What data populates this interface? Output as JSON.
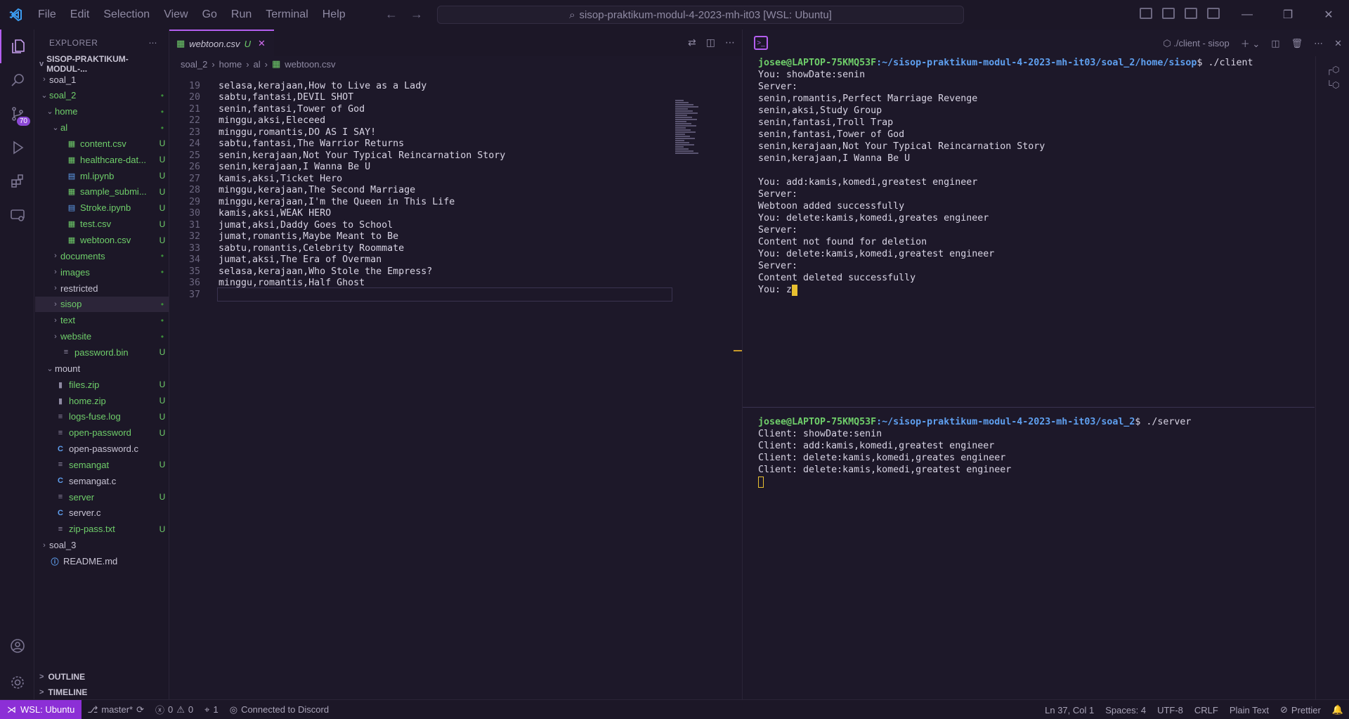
{
  "titlebar": {
    "menu": [
      "File",
      "Edit",
      "Selection",
      "View",
      "Go",
      "Run",
      "Terminal",
      "Help"
    ],
    "search_text": "sisop-praktikum-modul-4-2023-mh-it03 [WSL: Ubuntu]"
  },
  "activity": {
    "badge": "70"
  },
  "sidebar": {
    "header": "EXPLORER",
    "project": "SISOP-PRAKTIKUM-MODUL-...",
    "tree": [
      {
        "label": "soal_1",
        "chev": ">",
        "indent": 0,
        "type": "folder",
        "status": ""
      },
      {
        "label": "soal_2",
        "chev": "v",
        "indent": 0,
        "type": "folder",
        "status": "•",
        "green": true
      },
      {
        "label": "home",
        "chev": "v",
        "indent": 1,
        "type": "folder",
        "status": "•",
        "green": true
      },
      {
        "label": "al",
        "chev": "v",
        "indent": 2,
        "type": "folder",
        "status": "•",
        "green": true
      },
      {
        "label": "content.csv",
        "chev": "",
        "indent": 3,
        "type": "csv",
        "status": "U",
        "green": true
      },
      {
        "label": "healthcare-dat...",
        "chev": "",
        "indent": 3,
        "type": "csv",
        "status": "U",
        "green": true
      },
      {
        "label": "ml.ipynb",
        "chev": "",
        "indent": 3,
        "type": "nb",
        "status": "U",
        "green": true
      },
      {
        "label": "sample_submi...",
        "chev": "",
        "indent": 3,
        "type": "csv",
        "status": "U",
        "green": true
      },
      {
        "label": "Stroke.ipynb",
        "chev": "",
        "indent": 3,
        "type": "nb",
        "status": "U",
        "green": true
      },
      {
        "label": "test.csv",
        "chev": "",
        "indent": 3,
        "type": "csv",
        "status": "U",
        "green": true
      },
      {
        "label": "webtoon.csv",
        "chev": "",
        "indent": 3,
        "type": "csv",
        "status": "U",
        "green": true
      },
      {
        "label": "documents",
        "chev": ">",
        "indent": 2,
        "type": "folder",
        "status": "•",
        "green": true
      },
      {
        "label": "images",
        "chev": ">",
        "indent": 2,
        "type": "folder",
        "status": "•",
        "green": true
      },
      {
        "label": "restricted",
        "chev": ">",
        "indent": 2,
        "type": "folder",
        "status": ""
      },
      {
        "label": "sisop",
        "chev": ">",
        "indent": 2,
        "type": "folder",
        "status": "•",
        "green": true,
        "selected": true
      },
      {
        "label": "text",
        "chev": ">",
        "indent": 2,
        "type": "folder",
        "status": "•",
        "green": true
      },
      {
        "label": "website",
        "chev": ">",
        "indent": 2,
        "type": "folder",
        "status": "•",
        "green": true
      },
      {
        "label": "password.bin",
        "chev": "",
        "indent": 2,
        "type": "file",
        "status": "U",
        "green": true
      },
      {
        "label": "mount",
        "chev": "v",
        "indent": 1,
        "type": "folder",
        "status": ""
      },
      {
        "label": "files.zip",
        "chev": "",
        "indent": 1,
        "type": "zip",
        "status": "U",
        "green": true
      },
      {
        "label": "home.zip",
        "chev": "",
        "indent": 1,
        "type": "zip",
        "status": "U",
        "green": true
      },
      {
        "label": "logs-fuse.log",
        "chev": "",
        "indent": 1,
        "type": "file",
        "status": "U",
        "green": true
      },
      {
        "label": "open-password",
        "chev": "",
        "indent": 1,
        "type": "file",
        "status": "U",
        "green": true
      },
      {
        "label": "open-password.c",
        "chev": "",
        "indent": 1,
        "type": "c",
        "status": ""
      },
      {
        "label": "semangat",
        "chev": "",
        "indent": 1,
        "type": "file",
        "status": "U",
        "green": true
      },
      {
        "label": "semangat.c",
        "chev": "",
        "indent": 1,
        "type": "c",
        "status": ""
      },
      {
        "label": "server",
        "chev": "",
        "indent": 1,
        "type": "file",
        "status": "U",
        "green": true
      },
      {
        "label": "server.c",
        "chev": "",
        "indent": 1,
        "type": "c",
        "status": ""
      },
      {
        "label": "zip-pass.txt",
        "chev": "",
        "indent": 1,
        "type": "file",
        "status": "U",
        "green": true
      },
      {
        "label": "soal_3",
        "chev": ">",
        "indent": 0,
        "type": "folder",
        "status": ""
      },
      {
        "label": "README.md",
        "chev": "",
        "indent": 0,
        "type": "info",
        "status": ""
      }
    ],
    "outline": "OUTLINE",
    "timeline": "TIMELINE"
  },
  "editor": {
    "tab_name": "webtoon.csv",
    "tab_status": "U",
    "breadcrumb": [
      "soal_2",
      "home",
      "al",
      "webtoon.csv"
    ],
    "lines": [
      {
        "n": "19",
        "t": "selasa,kerajaan,How to Live as a Lady"
      },
      {
        "n": "20",
        "t": "sabtu,fantasi,DEVIL SHOT"
      },
      {
        "n": "21",
        "t": "senin,fantasi,Tower of God"
      },
      {
        "n": "22",
        "t": "minggu,aksi,Eleceed"
      },
      {
        "n": "23",
        "t": "minggu,romantis,DO AS I SAY!"
      },
      {
        "n": "24",
        "t": "sabtu,fantasi,The Warrior Returns"
      },
      {
        "n": "25",
        "t": "senin,kerajaan,Not Your Typical Reincarnation Story"
      },
      {
        "n": "26",
        "t": "senin,kerajaan,I Wanna Be U"
      },
      {
        "n": "27",
        "t": "kamis,aksi,Ticket Hero"
      },
      {
        "n": "28",
        "t": "minggu,kerajaan,The Second Marriage"
      },
      {
        "n": "29",
        "t": "minggu,kerajaan,I'm the Queen in This Life"
      },
      {
        "n": "30",
        "t": "kamis,aksi,WEAK HERO"
      },
      {
        "n": "31",
        "t": "jumat,aksi,Daddy Goes to School"
      },
      {
        "n": "32",
        "t": "jumat,romantis,Maybe Meant to Be"
      },
      {
        "n": "33",
        "t": "sabtu,romantis,Celebrity Roommate"
      },
      {
        "n": "34",
        "t": "jumat,aksi,The Era of Overman"
      },
      {
        "n": "35",
        "t": "selasa,kerajaan,Who Stole the Empress?"
      },
      {
        "n": "36",
        "t": "minggu,romantis,Half Ghost"
      },
      {
        "n": "37",
        "t": ""
      }
    ]
  },
  "terminal": {
    "title": "./client - sisop",
    "client": {
      "prompt_user": "josee@LAPTOP-75KMQ53F",
      "prompt_path": ":~/sisop-praktikum-modul-4-2023-mh-it03/soal_2/home/sisop",
      "command": "$ ./client",
      "output": [
        "You: showDate:senin",
        "Server:",
        "senin,romantis,Perfect Marriage Revenge",
        "senin,aksi,Study Group",
        "senin,fantasi,Troll Trap",
        "senin,fantasi,Tower of God",
        "senin,kerajaan,Not Your Typical Reincarnation Story",
        "senin,kerajaan,I Wanna Be U",
        "",
        "You: add:kamis,komedi,greatest engineer",
        "Server:",
        "Webtoon added successfully",
        "You: delete:kamis,komedi,greates engineer",
        "Server:",
        "Content not found for deletion",
        "You: delete:kamis,komedi,greatest engineer",
        "Server:",
        "Content deleted successfully"
      ],
      "last_line": "You: z"
    },
    "server": {
      "prompt_user": "josee@LAPTOP-75KMQ53F",
      "prompt_path": ":~/sisop-praktikum-modul-4-2023-mh-it03/soal_2",
      "command": "$ ./server",
      "output": [
        "Client: showDate:senin",
        "Client: add:kamis,komedi,greatest engineer",
        "Client: delete:kamis,komedi,greates engineer",
        "Client: delete:kamis,komedi,greatest engineer"
      ]
    }
  },
  "statusbar": {
    "remote": "WSL: Ubuntu",
    "branch": "master*",
    "errors": "0",
    "warnings": "0",
    "ports": "1",
    "discord": "Connected to Discord",
    "position": "Ln 37, Col 1",
    "spaces": "Spaces: 4",
    "encoding": "UTF-8",
    "eol": "CRLF",
    "language": "Plain Text",
    "prettier": "Prettier"
  },
  "colors": {
    "accent": "#b45ff0",
    "remote_bg": "#8c2fd6",
    "git_added": "#6fce6a"
  }
}
